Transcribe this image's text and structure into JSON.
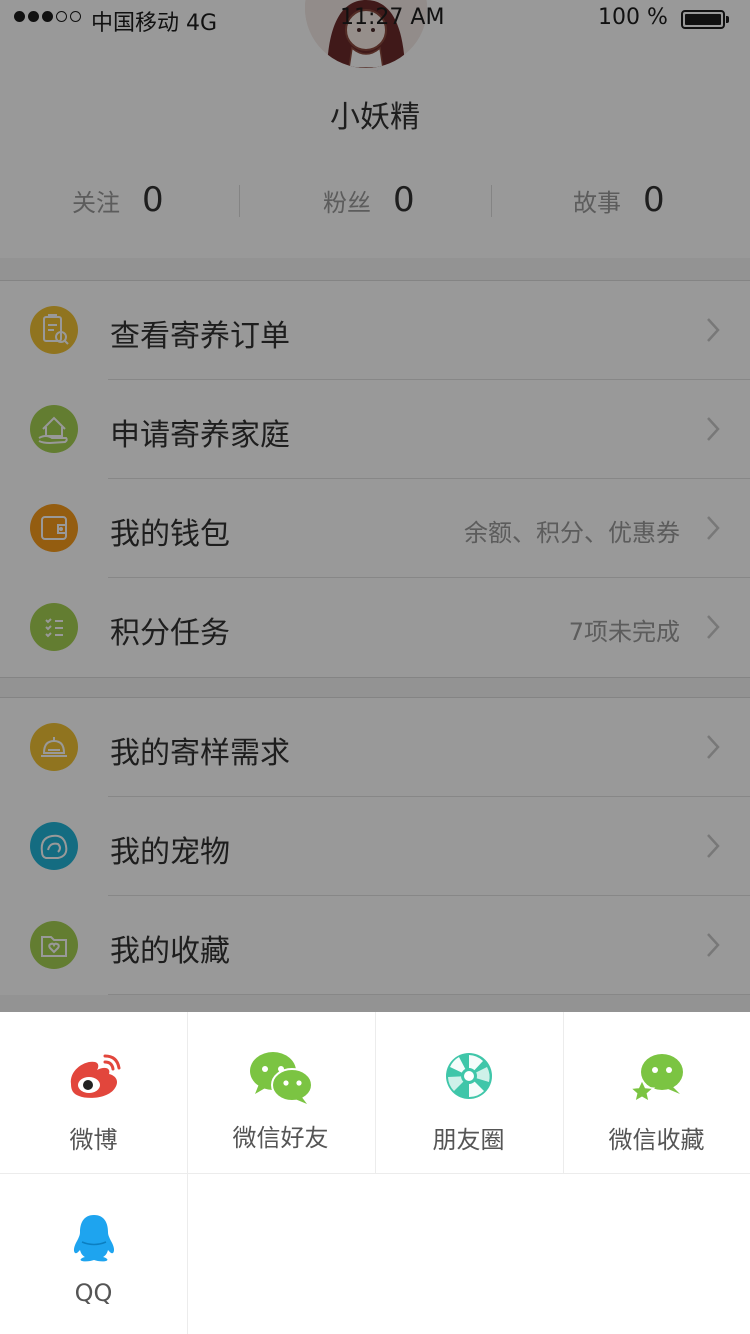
{
  "status_bar": {
    "carrier": "中国移动 4G",
    "time": "11:27 AM",
    "battery_percent": "100 %"
  },
  "profile": {
    "username": "小妖精",
    "stats": [
      {
        "label": "关注",
        "value": "0"
      },
      {
        "label": "粉丝",
        "value": "0"
      },
      {
        "label": "故事",
        "value": "0"
      }
    ]
  },
  "menu_group_1": [
    {
      "label": "查看寄养订单",
      "sub": "",
      "icon": "clipboard-search-icon",
      "color": "#f1c234"
    },
    {
      "label": "申请寄养家庭",
      "sub": "",
      "icon": "hand-house-icon",
      "color": "#a5d052"
    },
    {
      "label": "我的钱包",
      "sub": "余额、积分、优惠券",
      "icon": "wallet-icon",
      "color": "#f79b1c"
    },
    {
      "label": "积分任务",
      "sub": "7项未完成",
      "icon": "checklist-icon",
      "color": "#a5d052"
    }
  ],
  "menu_group_2": [
    {
      "label": "我的寄样需求",
      "sub": "",
      "icon": "service-bell-icon",
      "color": "#f1c234"
    },
    {
      "label": "我的宠物",
      "sub": "",
      "icon": "pet-icon",
      "color": "#22b5d8"
    },
    {
      "label": "我的收藏",
      "sub": "",
      "icon": "heart-folder-icon",
      "color": "#a5d052"
    }
  ],
  "share": {
    "items": [
      {
        "label": "微博",
        "icon": "weibo-icon",
        "color": "#e2463c"
      },
      {
        "label": "微信好友",
        "icon": "wechat-icon",
        "color": "#7bc442"
      },
      {
        "label": "朋友圈",
        "icon": "moments-icon",
        "color": "#3fc6a9"
      },
      {
        "label": "微信收藏",
        "icon": "wechat-favorites-icon",
        "color": "#7bc442"
      },
      {
        "label": "QQ",
        "icon": "qq-icon",
        "color": "#1ea4ef"
      }
    ]
  }
}
